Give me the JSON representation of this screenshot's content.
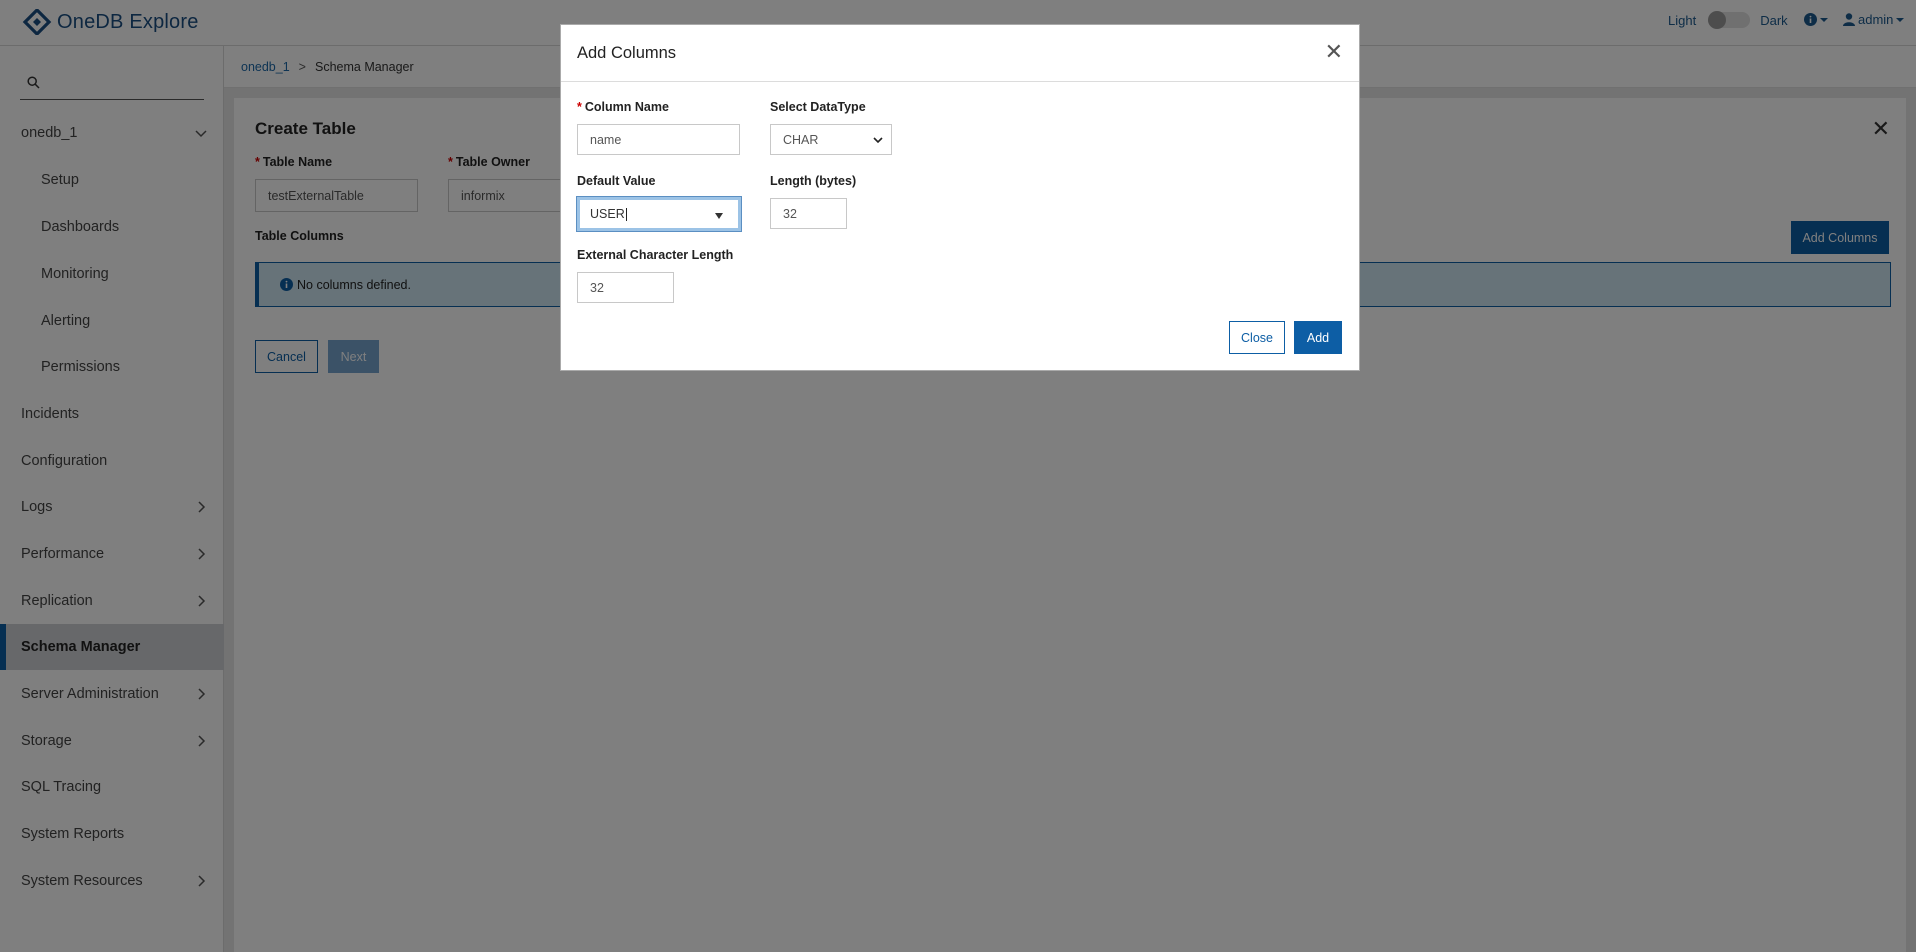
{
  "app": {
    "name": "OneDB Explore",
    "theme_light": "Light",
    "theme_dark": "Dark",
    "user": "admin"
  },
  "sidebar": {
    "search_placeholder": "",
    "items": [
      {
        "label": "onedb_1"
      },
      {
        "label": "Setup"
      },
      {
        "label": "Dashboards"
      },
      {
        "label": "Monitoring"
      },
      {
        "label": "Alerting"
      },
      {
        "label": "Permissions"
      },
      {
        "label": "Incidents"
      },
      {
        "label": "Configuration"
      },
      {
        "label": "Logs"
      },
      {
        "label": "Performance"
      },
      {
        "label": "Replication"
      },
      {
        "label": "Schema Manager"
      },
      {
        "label": "Server Administration"
      },
      {
        "label": "Storage"
      },
      {
        "label": "SQL Tracing"
      },
      {
        "label": "System Reports"
      },
      {
        "label": "System Resources"
      }
    ]
  },
  "breadcrumb": {
    "root": "onedb_1",
    "separator": ">",
    "current": "Schema Manager"
  },
  "create_table": {
    "title": "Create Table",
    "table_name_label": "Table Name",
    "table_name_value": "testExternalTable",
    "table_owner_label": "Table Owner",
    "table_owner_value": "informix",
    "columns_label": "Table Columns",
    "add_columns_button": "Add Columns",
    "empty_message": "No columns defined.",
    "cancel_button": "Cancel",
    "next_button": "Next"
  },
  "modal": {
    "title": "Add Columns",
    "column_name_label": "Column Name",
    "column_name_value": "name",
    "datatype_label": "Select DataType",
    "datatype_value": "CHAR",
    "default_value_label": "Default Value",
    "default_value_value": "USER",
    "length_label": "Length (bytes)",
    "length_value": "32",
    "ext_char_length_label": "External Character Length",
    "ext_char_length_value": "32",
    "close_button": "Close",
    "add_button": "Add"
  },
  "colors": {
    "primary": "#0d5ea5",
    "logo": "#1b4f83",
    "alert_bg": "#cfe7f3"
  }
}
